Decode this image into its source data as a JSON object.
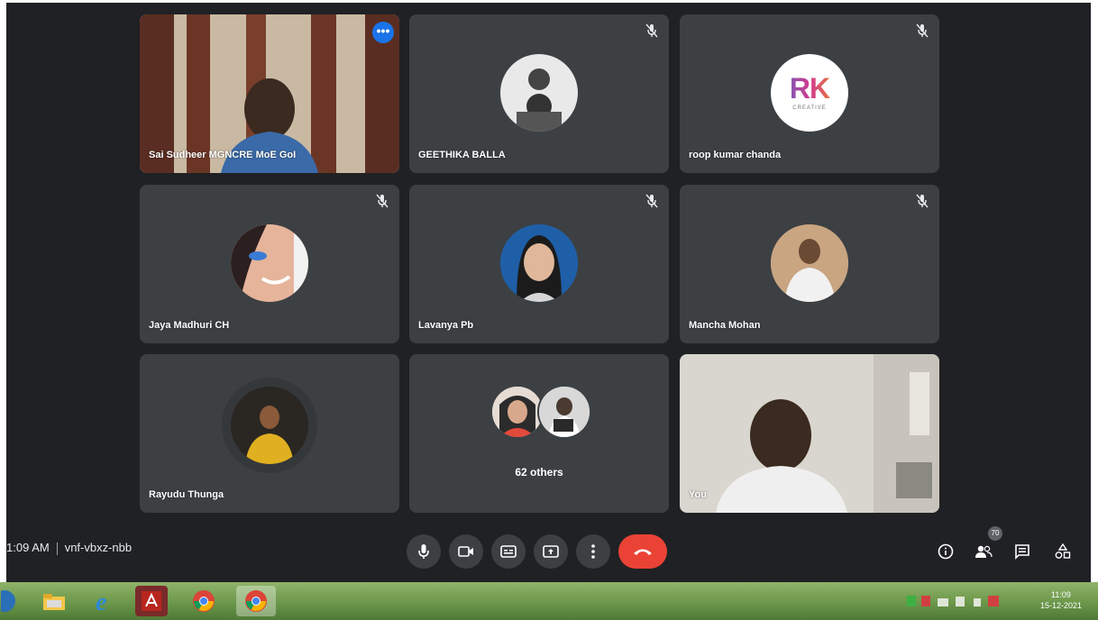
{
  "participants": [
    {
      "name": "Sai Sudheer MGNCRE MoE GoI",
      "speaking": true
    },
    {
      "name": "GEETHIKA BALLA"
    },
    {
      "name": "roop kumar chanda",
      "avatar_text": "RK",
      "avatar_subtext": "CREATIVE"
    },
    {
      "name": "Jaya Madhuri CH"
    },
    {
      "name": "Lavanya Pb"
    },
    {
      "name": "Mancha Mohan"
    },
    {
      "name": "Rayudu Thunga"
    },
    {
      "others_label": "62 others"
    },
    {
      "name": "You"
    }
  ],
  "meeting": {
    "time": "1:09 AM",
    "code": "vnf-vbxz-nbb"
  },
  "controls": {
    "mic": "mic-icon",
    "camera": "camera-icon",
    "captions": "captions-icon",
    "present": "present-icon",
    "more": "more-vert-icon",
    "end": "call-end-icon",
    "more_dots": "•••"
  },
  "right_controls": {
    "people_count": "70"
  },
  "taskbar": {
    "time": "11:09",
    "date": "15-12-2021"
  },
  "colors": {
    "background": "#202124",
    "tile": "#3c4043",
    "accent": "#8ab4f8",
    "end_call": "#ea4335",
    "blue_button": "#1a73e8"
  }
}
